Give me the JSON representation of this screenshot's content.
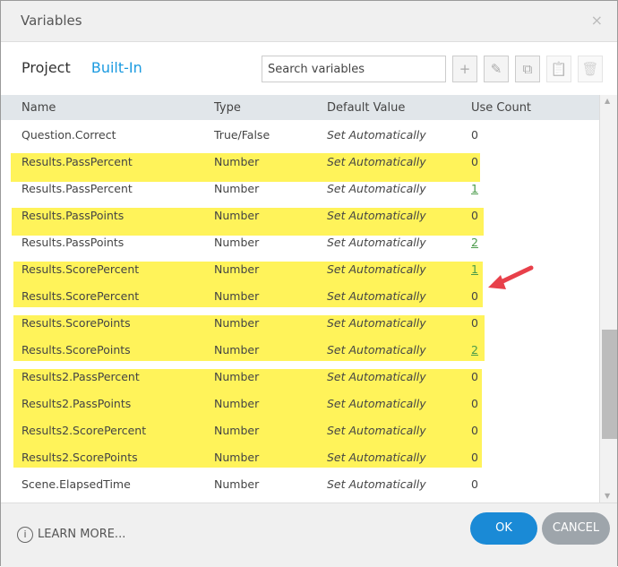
{
  "title": "Variables",
  "close": "×",
  "tabs": [
    "Project",
    "Built-In"
  ],
  "search_placeholder": "Search variables",
  "toolbar": {
    "add": "+",
    "edit": "✎",
    "copy": "⧉",
    "paste": "📋",
    "delete": "🗑"
  },
  "columns": [
    "Name",
    "Type",
    "Default Value",
    "Use Count"
  ],
  "rows": [
    {
      "name": "Question.Correct",
      "type": "True/False",
      "default": "Set Automatically",
      "count": "0"
    },
    {
      "name": "Results.PassPercent",
      "type": "Number",
      "default": "Set Automatically",
      "count": "0"
    },
    {
      "name": "Results.PassPercent",
      "type": "Number",
      "default": "Set Automatically",
      "count": "1"
    },
    {
      "name": "Results.PassPoints",
      "type": "Number",
      "default": "Set Automatically",
      "count": "0"
    },
    {
      "name": "Results.PassPoints",
      "type": "Number",
      "default": "Set Automatically",
      "count": "2"
    },
    {
      "name": "Results.ScorePercent",
      "type": "Number",
      "default": "Set Automatically",
      "count": "1"
    },
    {
      "name": "Results.ScorePercent",
      "type": "Number",
      "default": "Set Automatically",
      "count": "0"
    },
    {
      "name": "Results.ScorePoints",
      "type": "Number",
      "default": "Set Automatically",
      "count": "0"
    },
    {
      "name": "Results.ScorePoints",
      "type": "Number",
      "default": "Set Automatically",
      "count": "2"
    },
    {
      "name": "Results2.PassPercent",
      "type": "Number",
      "default": "Set Automatically",
      "count": "0"
    },
    {
      "name": "Results2.PassPoints",
      "type": "Number",
      "default": "Set Automatically",
      "count": "0"
    },
    {
      "name": "Results2.ScorePercent",
      "type": "Number",
      "default": "Set Automatically",
      "count": "0"
    },
    {
      "name": "Results2.ScorePoints",
      "type": "Number",
      "default": "Set Automatically",
      "count": "0"
    },
    {
      "name": "Scene.ElapsedTime",
      "type": "Number",
      "default": "Set Automatically",
      "count": "0"
    }
  ],
  "footer": {
    "learn_more": "LEARN MORE...",
    "info": "i",
    "ok": "OK",
    "cancel": "CANCEL"
  },
  "colors": {
    "highlight": "#fff35a",
    "accent": "#1a8ad6"
  }
}
